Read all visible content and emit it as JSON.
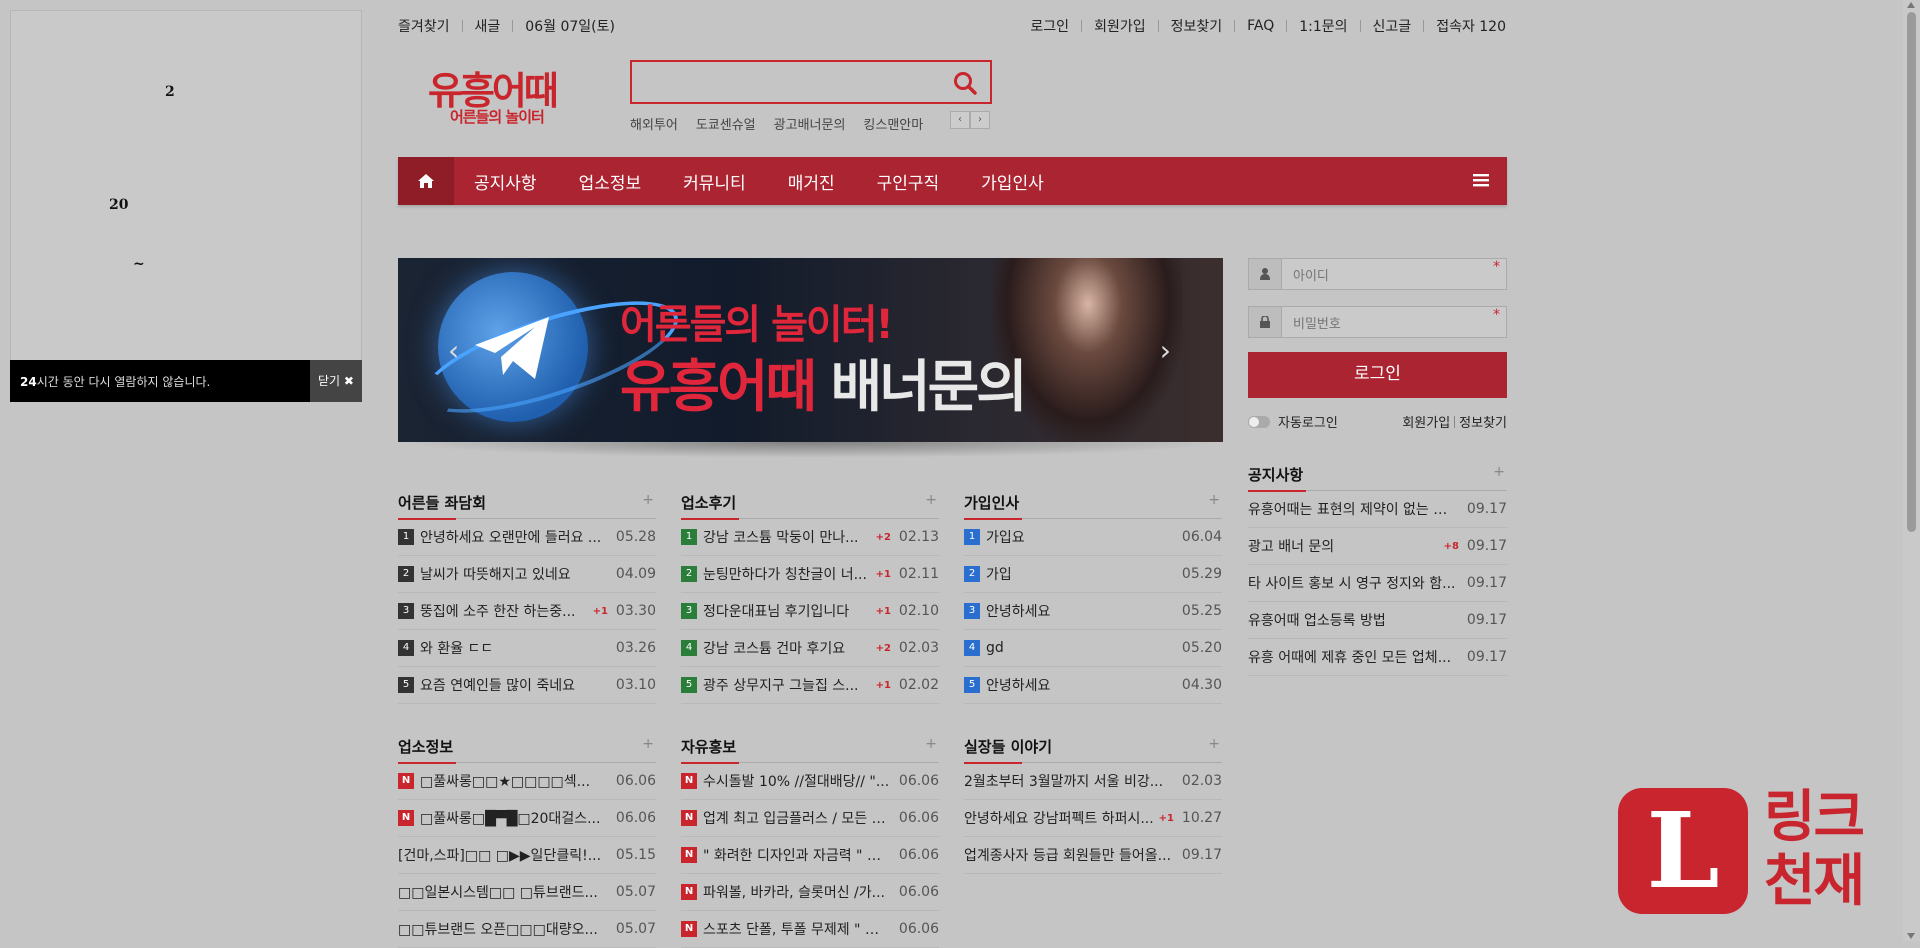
{
  "popup": {
    "line1": "2",
    "line2": "20",
    "line3": "~",
    "footer_bold": "24",
    "footer_text": "시간 동안 다시 열람하지 않습니다.",
    "close_label": "닫기"
  },
  "toplinks_left": [
    "즐겨찾기",
    "새글",
    "06월 07일(토)"
  ],
  "toplinks_right": [
    "로그인",
    "회원가입",
    "정보찾기",
    "FAQ",
    "1:1문의",
    "신고글",
    "접속자 120"
  ],
  "logo": {
    "line1": "유흥어때",
    "line2": "어른들의 놀이터"
  },
  "search": {
    "value": "",
    "tags": [
      "해외투어",
      "도쿄센슈얼",
      "광고배너문의",
      "킹스맨안마"
    ],
    "prev": "‹",
    "next": "›"
  },
  "nav": {
    "items": [
      "공지사항",
      "업소정보",
      "커뮤니티",
      "매거진",
      "구인구직",
      "가입인사"
    ]
  },
  "banner": {
    "line1": "어른들의 놀이터!",
    "line2_red": "유흥어때",
    "line2_white": "배너문의"
  },
  "boards": {
    "b1": {
      "title": "어른들 좌담회",
      "items": [
        {
          "num": "1",
          "subj": "안녕하세요 오랜만에 들러요 ...",
          "cmt": "",
          "date": "05.28"
        },
        {
          "num": "2",
          "subj": "날씨가 따뜻해지고 있네요",
          "cmt": "",
          "date": "04.09"
        },
        {
          "num": "3",
          "subj": "뚱집에 소주 한잔 하는중...",
          "cmt": "+1",
          "date": "03.30"
        },
        {
          "num": "4",
          "subj": "와 환율 ㄷㄷ",
          "cmt": "",
          "date": "03.26"
        },
        {
          "num": "5",
          "subj": "요즘 연예인들 많이 죽네요",
          "cmt": "",
          "date": "03.10"
        }
      ]
    },
    "b2": {
      "title": "업소후기",
      "items": [
        {
          "num": "1",
          "subj": "강남 코스튬 막둥이 만나...",
          "cmt": "+2",
          "date": "02.13"
        },
        {
          "num": "2",
          "subj": "눈팅만하다가 칭찬글이 너...",
          "cmt": "+1",
          "date": "02.11"
        },
        {
          "num": "3",
          "subj": "정다운대표님 후기입니다",
          "cmt": "+1",
          "date": "02.10"
        },
        {
          "num": "4",
          "subj": "강남 코스튬 건마 후기요",
          "cmt": "+2",
          "date": "02.03"
        },
        {
          "num": "5",
          "subj": "광주 상무지구 그늘집 스...",
          "cmt": "+1",
          "date": "02.02"
        }
      ]
    },
    "b3": {
      "title": "가입인사",
      "items": [
        {
          "num": "1",
          "subj": "가입요",
          "cmt": "",
          "date": "06.04"
        },
        {
          "num": "2",
          "subj": "가입",
          "cmt": "",
          "date": "05.29"
        },
        {
          "num": "3",
          "subj": "안녕하세요",
          "cmt": "",
          "date": "05.25"
        },
        {
          "num": "4",
          "subj": "gd",
          "cmt": "",
          "date": "05.20"
        },
        {
          "num": "5",
          "subj": "안녕하세요",
          "cmt": "",
          "date": "04.30"
        }
      ]
    },
    "b4": {
      "title": "업소정보",
      "items": [
        {
          "num": "N",
          "subj": "□풀싸롱□□★□□□□섹...",
          "cmt": "",
          "date": "06.06"
        },
        {
          "num": "N",
          "subj": "□풀싸롱□█▀█□20대걸스...",
          "cmt": "",
          "date": "06.06"
        },
        {
          "num": "",
          "subj": "[건마,스파]□□ □▶▶일단클릭!...",
          "cmt": "",
          "date": "05.15"
        },
        {
          "num": "",
          "subj": "□□일본시스템□□ □튜브랜드...",
          "cmt": "",
          "date": "05.07"
        },
        {
          "num": "",
          "subj": "□□튜브랜드 오픈□□□대량오...",
          "cmt": "",
          "date": "05.07"
        }
      ]
    },
    "b5": {
      "title": "자유홍보",
      "items": [
        {
          "num": "N",
          "subj": "수시돌발 10% //절대배당// \"...",
          "cmt": "",
          "date": "06.06"
        },
        {
          "num": "N",
          "subj": "업계 최고 입금플러스 / 모든 게...",
          "cmt": "",
          "date": "06.06"
        },
        {
          "num": "N",
          "subj": "\" 화려한 디자인과 자금력 \" 카...",
          "cmt": "",
          "date": "06.06"
        },
        {
          "num": "N",
          "subj": "파워볼, 바카라, 슬롯머신 /가...",
          "cmt": "",
          "date": "06.06"
        },
        {
          "num": "N",
          "subj": "스포츠 단폴, 투폴 무제제 \" 승...",
          "cmt": "",
          "date": "06.06"
        }
      ]
    },
    "b6": {
      "title": "실장들 이야기",
      "items": [
        {
          "num": "",
          "subj": "2월초부터 3월말까지 서울 비강...",
          "cmt": "",
          "date": "02.03"
        },
        {
          "num": "",
          "subj": "안녕하세요 강남퍼펙트 하퍼시...",
          "cmt": "+1",
          "date": "10.27"
        },
        {
          "num": "",
          "subj": "업계종사자 등급 회원들만 들어올...",
          "cmt": "",
          "date": "09.17"
        }
      ]
    }
  },
  "board_plus": "+",
  "login": {
    "id_placeholder": "아이디",
    "pw_placeholder": "비밀번호",
    "required_mark": "*",
    "button": "로그인",
    "auto_login": "자동로그인",
    "join": "회원가입",
    "find": "정보찾기"
  },
  "notice": {
    "title": "공지사항",
    "items": [
      {
        "subj": "유흥어때는 표현의 제약이 없는 자...",
        "cmt": "",
        "date": "09.17"
      },
      {
        "subj": "광고 배너 문의",
        "cmt": "+8",
        "date": "09.17"
      },
      {
        "subj": "타 사이트 홍보 시 영구 정지와 함...",
        "cmt": "",
        "date": "09.17"
      },
      {
        "subj": "유흥어때 업소등록 방법",
        "cmt": "",
        "date": "09.17"
      },
      {
        "subj": "유흥 어때에 제휴 중인 모든 업체...",
        "cmt": "",
        "date": "09.17"
      }
    ]
  },
  "watermark": {
    "letter": "L",
    "text_line1": "링크",
    "text_line2": "천재"
  },
  "colors": {
    "brand": "#ab2432",
    "accent": "#c9252c",
    "background": "#c5c5c5"
  }
}
